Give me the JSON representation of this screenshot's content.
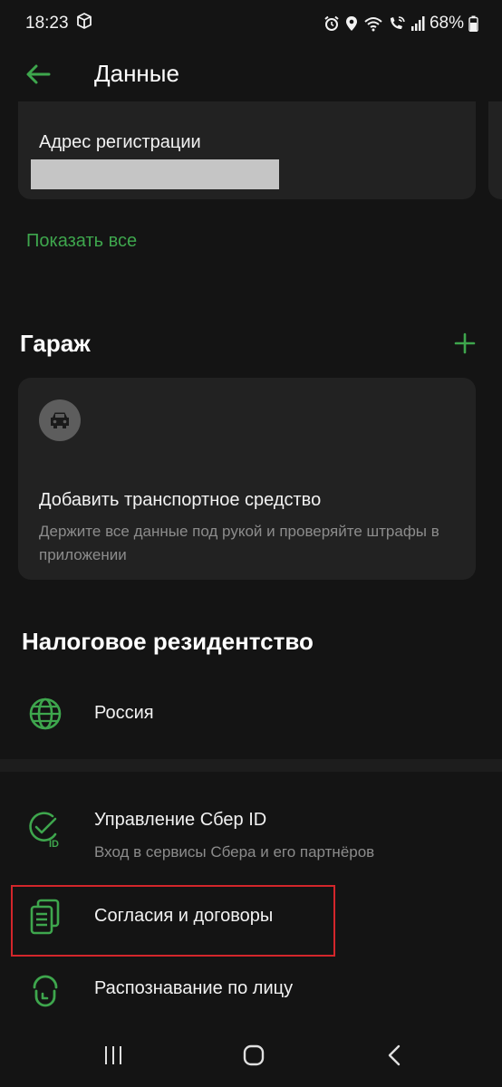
{
  "status_bar": {
    "time": "18:23",
    "battery": "68%",
    "icons": [
      "package-icon",
      "alarm-icon",
      "location-icon",
      "wifi-icon",
      "wifi-calling-icon",
      "signal-icon",
      "battery-icon"
    ]
  },
  "header": {
    "title": "Данные",
    "back_icon": "arrow-left-icon"
  },
  "address_card": {
    "label": "Адрес регистрации",
    "value_redacted": true
  },
  "show_all": "Показать все",
  "garage": {
    "title": "Гараж",
    "add_icon": "plus-icon",
    "card": {
      "icon": "car-icon",
      "title": "Добавить транспортное средство",
      "subtitle": "Держите все данные под рукой и проверяйте штрафы в приложении"
    }
  },
  "tax_residency": {
    "title": "Налоговое резидентство",
    "item": {
      "icon": "globe-icon",
      "label": "Россия"
    }
  },
  "settings": {
    "items": [
      {
        "icon": "sber-id-icon",
        "label": "Управление Сбер ID",
        "subtitle": "Вход в сервисы Сбера и его партнёров"
      },
      {
        "icon": "documents-icon",
        "label": "Согласия и договоры"
      },
      {
        "icon": "face-recognition-icon",
        "label": "Распознавание по лицу"
      }
    ]
  },
  "colors": {
    "accent": "#3ea64d",
    "background": "#141414",
    "card": "#222222",
    "highlight": "#d3262b"
  },
  "nav_bar": {
    "buttons": [
      "recents-icon",
      "home-icon",
      "back-icon"
    ]
  }
}
